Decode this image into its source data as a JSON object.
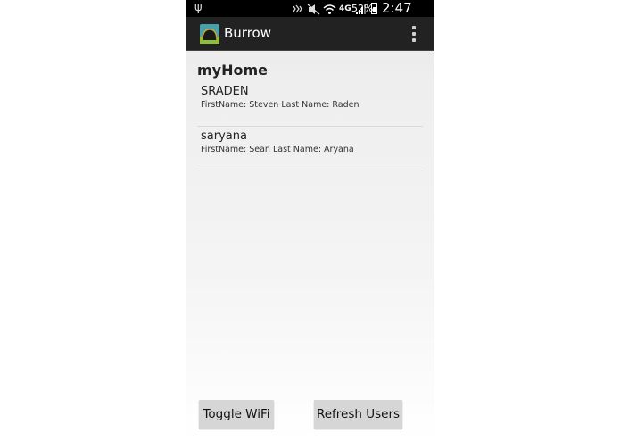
{
  "status_bar": {
    "battery_percent": "52%",
    "time": "2:47 PM",
    "network_label": "4G",
    "icons": [
      "usb-icon",
      "nfc-icon",
      "mute-icon",
      "wifi-icon",
      "4g-icon",
      "signal-icon",
      "battery-icon"
    ]
  },
  "action_bar": {
    "title": "Burrow",
    "menu_icon": "overflow-menu-icon"
  },
  "home": {
    "title": "myHome",
    "users": [
      {
        "username": "SRADEN",
        "details": "FirstName: Steven  Last Name: Raden"
      },
      {
        "username": "saryana",
        "details": "FirstName: Sean  Last Name: Aryana"
      }
    ]
  },
  "buttons": {
    "toggle_wifi": "Toggle WiFi",
    "refresh_users": "Refresh Users"
  }
}
